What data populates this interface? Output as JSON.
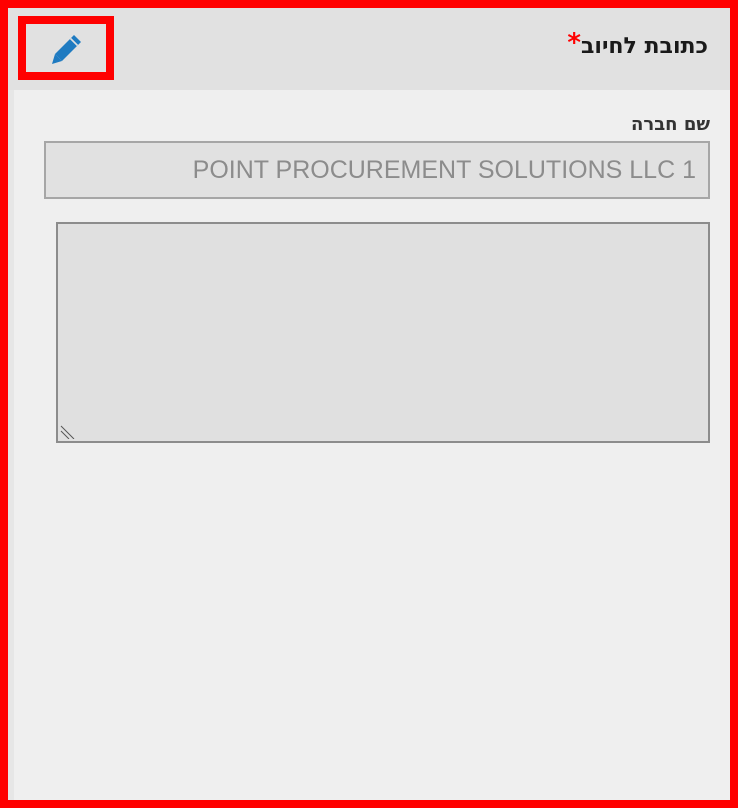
{
  "section": {
    "title": "כתובת לחיוב",
    "required_marker": "*"
  },
  "toolbar": {
    "edit_icon": "pencil-icon",
    "highlight_color": "#ff0000",
    "icon_color": "#1f7bc1"
  },
  "company_field": {
    "label": "שם חברה",
    "value": "POINT PROCUREMENT SOLUTIONS LLC 1"
  },
  "address_field": {
    "value": ""
  }
}
